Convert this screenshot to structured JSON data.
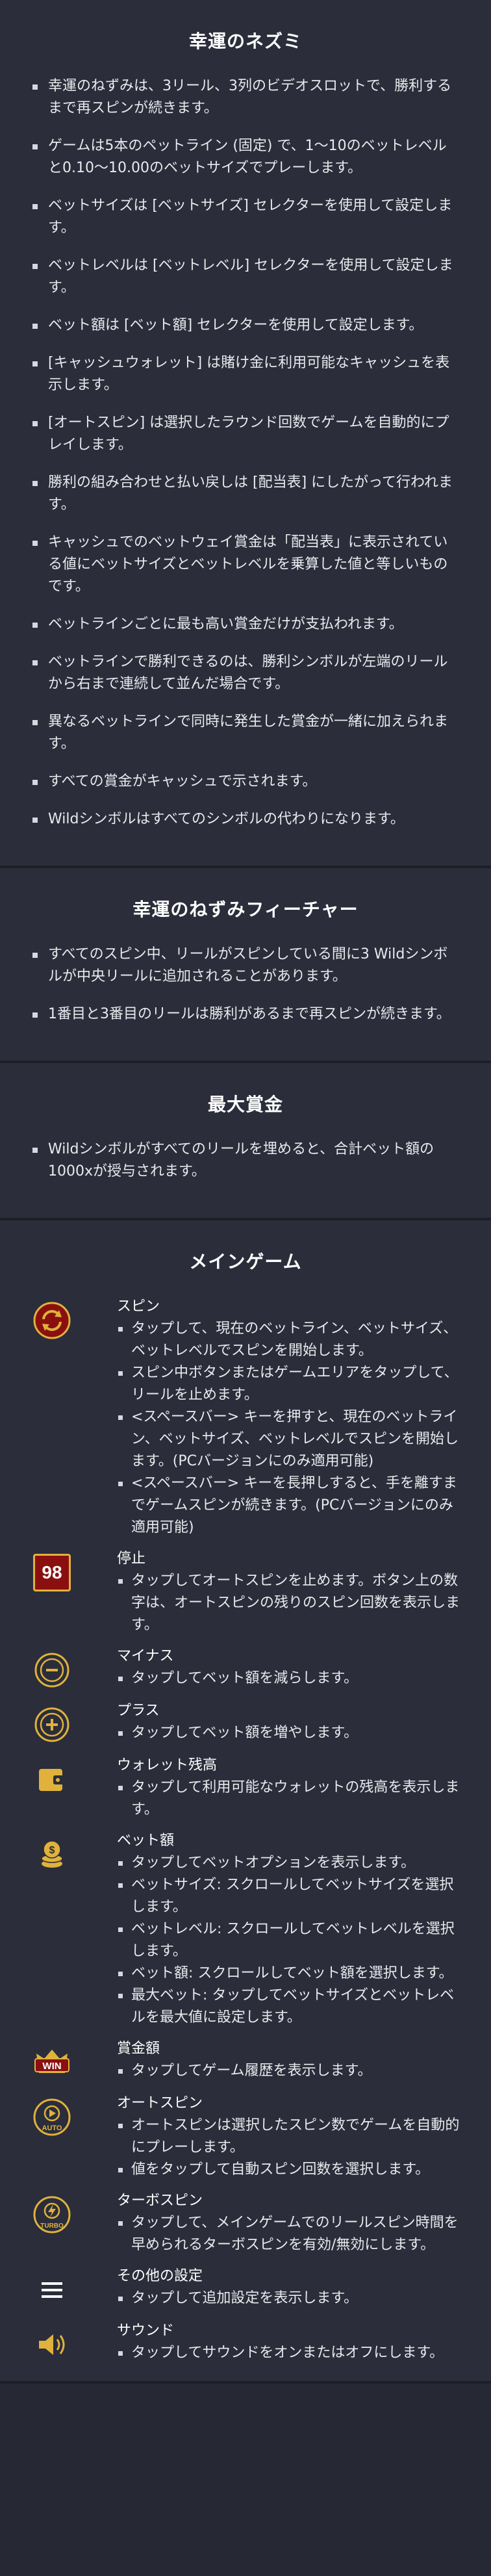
{
  "rules": {
    "title": "幸運のネズミ",
    "items": [
      "幸運のねずみは、3リール、3列のビデオスロットで、勝利するまで再スピンが続きます。",
      "ゲームは5本のペットライン (固定) で、1～10のベットレベルと0.10～10.00のベットサイズでプレーします。",
      "ベットサイズは [ベットサイズ] セレクターを使用して設定します。",
      "ベットレベルは [ベットレベル] セレクターを使用して設定します。",
      "ベット額は [ベット額] セレクターを使用して設定します。",
      "[キャッシュウォレット] は賭け金に利用可能なキャッシュを表示します。",
      "[オートスピン] は選択したラウンド回数でゲームを自動的にプレイします。",
      "勝利の組み合わせと払い戻しは [配当表] にしたがって行われます。",
      "キャッシュでのベットウェイ賞金は「配当表」に表示されている値にベットサイズとベットレベルを乗算した値と等しいものです。",
      "ベットラインごとに最も高い賞金だけが支払われます。",
      "ベットラインで勝利できるのは、勝利シンボルが左端のリールから右まで連続して並んだ場合です。",
      "異なるベットラインで同時に発生した賞金が一緒に加えられます。",
      "すべての賞金がキャッシュで示されます。",
      "Wildシンボルはすべてのシンボルの代わりになります。"
    ]
  },
  "feature": {
    "title": "幸運のねずみフィーチャー",
    "items": [
      "すべてのスピン中、リールがスピンしている間に3 Wildシンボルが中央リールに追加されることがあります。",
      "1番目と3番目のリールは勝利があるまで再スピンが続きます。"
    ]
  },
  "max_win": {
    "title": "最大賞金",
    "items": [
      "Wildシンボルがすべてのリールを埋めると、合計ベット額の1000xが授与されます。"
    ]
  },
  "main_game": {
    "title": "メインゲーム",
    "stop_badge": "98",
    "features": [
      {
        "icon": "spin-icon",
        "title": "スピン",
        "items": [
          "タップして、現在のベットライン、ベットサイズ、ベットレベルでスピンを開始します。",
          "スピン中ボタンまたはゲームエリアをタップして、リールを止めます。",
          "<スペースバー> キーを押すと、現在のベットライン、ベットサイズ、ベットレベルでスピンを開始します。(PCバージョンにのみ適用可能)",
          "<スペースバー> キーを長押しすると、手を離すまでゲームスピンが続きます。(PCバージョンにのみ適用可能)"
        ]
      },
      {
        "icon": "stop-icon",
        "title": "停止",
        "items": [
          "タップしてオートスピンを止めます。ボタン上の数字は、オートスピンの残りのスピン回数を表示します。"
        ]
      },
      {
        "icon": "minus-icon",
        "title": "マイナス",
        "items": [
          "タップしてベット額を減らします。"
        ]
      },
      {
        "icon": "plus-icon",
        "title": "プラス",
        "items": [
          "タップしてベット額を増やします。"
        ]
      },
      {
        "icon": "wallet-icon",
        "title": "ウォレット残高",
        "items": [
          "タップして利用可能なウォレットの残高を表示します。"
        ]
      },
      {
        "icon": "coins-icon",
        "title": "ベット額",
        "items": [
          "タップしてベットオプションを表示します。",
          "ベットサイズ: スクロールしてベットサイズを選択します。",
          "ベットレベル: スクロールしてベットレベルを選択します。",
          "ベット額: スクロールしてベット額を選択します。",
          "最大ベット: タップしてベットサイズとベットレベルを最大値に設定します。"
        ]
      },
      {
        "icon": "win-icon",
        "title": "賞金額",
        "items": [
          "タップしてゲーム履歴を表示します。"
        ]
      },
      {
        "icon": "autospin-icon",
        "title": "オートスピン",
        "items": [
          "オートスピンは選択したスピン数でゲームを自動的にプレーします。",
          "値をタップして自動スピン回数を選択します。"
        ]
      },
      {
        "icon": "turbo-icon",
        "title": "ターボスピン",
        "items": [
          "タップして、メインゲームでのリールスピン時間を早められるターボスピンを有効/無効にします。"
        ]
      },
      {
        "icon": "menu-icon",
        "title": "その他の設定",
        "items": [
          "タップして追加設定を表示します。"
        ]
      },
      {
        "icon": "sound-icon",
        "title": "サウンド",
        "items": [
          "タップしてサウンドをオンまたはオフにします。"
        ]
      }
    ],
    "icon_labels": {
      "win": "WIN",
      "auto": "AUTO",
      "turbo": "TURBO"
    }
  },
  "colors": {
    "background": "#2b2d3a",
    "accent_gold": "#e0b23c",
    "accent_red": "#8a1010"
  }
}
